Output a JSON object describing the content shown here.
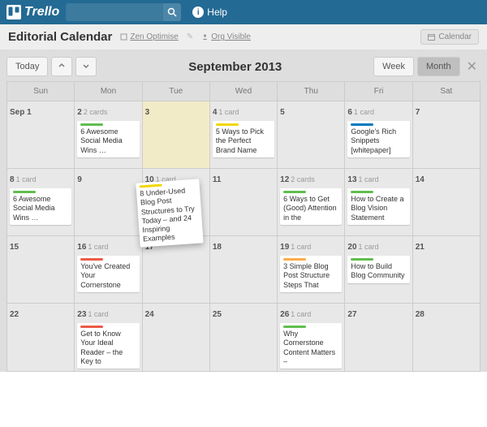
{
  "topbar": {
    "logo_text": "Trello",
    "search_placeholder": "",
    "help_label": "Help"
  },
  "boardbar": {
    "title": "Editorial Calendar",
    "org": "Zen Optimise",
    "visibility": "Org Visible",
    "calendar_btn": "Calendar"
  },
  "calheader": {
    "today": "Today",
    "title": "September 2013",
    "week": "Week",
    "month": "Month"
  },
  "dayheaders": [
    "Sun",
    "Mon",
    "Tue",
    "Wed",
    "Thu",
    "Fri",
    "Sat"
  ],
  "labelColors": {
    "green": "#61bd4f",
    "yellow": "#f2d600",
    "red": "#eb5a46",
    "blue": "#0079bf",
    "orange": "#ffab4a"
  },
  "weeks": [
    [
      {
        "num": "Sep 1"
      },
      {
        "num": "2",
        "count": "2 cards",
        "cards": [
          {
            "color": "green",
            "text": "6 Awesome Social Media Wins … "
          }
        ]
      },
      {
        "num": "3",
        "hl": true
      },
      {
        "num": "4",
        "count": "1 card",
        "cards": [
          {
            "color": "yellow",
            "text": "5 Ways to Pick the Perfect Brand Name"
          }
        ]
      },
      {
        "num": "5"
      },
      {
        "num": "6",
        "count": "1 card",
        "cards": [
          {
            "color": "blue",
            "text": "Google's Rich Snippets [whitepaper]"
          }
        ]
      },
      {
        "num": "7"
      }
    ],
    [
      {
        "num": "8",
        "count": "1 card",
        "cards": [
          {
            "color": "green",
            "text": "6 Awesome Social Media Wins … "
          }
        ]
      },
      {
        "num": "9"
      },
      {
        "num": "10",
        "count": "1 card",
        "ghost": true,
        "floating": {
          "color": "yellow",
          "text": "8 Under-Used Blog Post Structures to Try Today – and 24 Inspiring Examples"
        }
      },
      {
        "num": "11"
      },
      {
        "num": "12",
        "count": "2 cards",
        "cards": [
          {
            "color": "green",
            "text": "6 Ways to Get (Good) Attention in the "
          }
        ]
      },
      {
        "num": "13",
        "count": "1 card",
        "cards": [
          {
            "color": "green",
            "text": "How to Create a Blog Vision Statement "
          }
        ]
      },
      {
        "num": "14"
      }
    ],
    [
      {
        "num": "15"
      },
      {
        "num": "16",
        "count": "1 card",
        "cards": [
          {
            "color": "red",
            "text": "You've Created Your Cornerstone "
          }
        ]
      },
      {
        "num": "17"
      },
      {
        "num": "18"
      },
      {
        "num": "19",
        "count": "1 card",
        "cards": [
          {
            "color": "orange",
            "text": "3 Simple Blog Post Structure Steps That "
          }
        ]
      },
      {
        "num": "20",
        "count": "1 card",
        "cards": [
          {
            "color": "green",
            "text": "How to Build Blog Community"
          }
        ]
      },
      {
        "num": "21"
      }
    ],
    [
      {
        "num": "22"
      },
      {
        "num": "23",
        "count": "1 card",
        "cards": [
          {
            "color": "red",
            "text": "Get to Know Your Ideal Reader – the Key to "
          }
        ]
      },
      {
        "num": "24"
      },
      {
        "num": "25"
      },
      {
        "num": "26",
        "count": "1 card",
        "cards": [
          {
            "color": "green",
            "text": "Why Cornerstone Content Matters – "
          }
        ]
      },
      {
        "num": "27"
      },
      {
        "num": "28"
      }
    ]
  ]
}
